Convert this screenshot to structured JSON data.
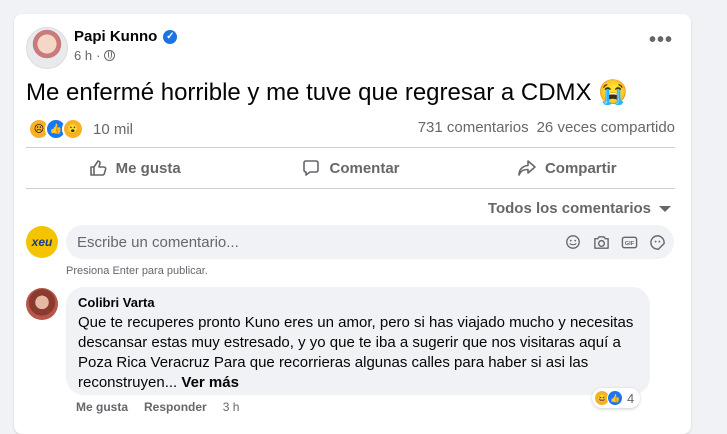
{
  "post": {
    "author": "Papi Kunno",
    "time": "6 h",
    "dot": "·",
    "text": "Me enfermé horrible y me tuve que regresar a CDMX 😭",
    "more": "•••"
  },
  "reactions": {
    "icons": [
      "sad-emoji-icon",
      "like-icon",
      "wow-emoji-icon"
    ],
    "count": "10 mil",
    "comments": "731 comentarios",
    "shares": "26 veces compartido"
  },
  "actions": {
    "like": "Me gusta",
    "comment": "Comentar",
    "share": "Compartir"
  },
  "filter": {
    "label": "Todos los comentarios"
  },
  "composer": {
    "page_avatar_text": "xeu",
    "placeholder": "Escribe un comentario...",
    "hint": "Presiona Enter para publicar.",
    "icons": [
      "emoji-icon",
      "camera-icon",
      "gif-icon",
      "sticker-icon"
    ]
  },
  "comment": {
    "author": "Colibri Varta",
    "text": "Que te recuperes pronto Kuno eres un amor, pero si has viajado mucho y necesitas descansar estas muy estresado, y yo que te iba a sugerir que nos visitaras aquí a Poza Rica Veracruz Para que recorrieras algunas calles para haber si asi las reconstruyen...",
    "see_more": "Ver más",
    "like": "Me gusta",
    "reply": "Responder",
    "time": "3 h",
    "reaction_count": "4"
  },
  "colors": {
    "accent": "#1877f2",
    "muted": "#65676b",
    "bubble": "#f0f2f5"
  }
}
